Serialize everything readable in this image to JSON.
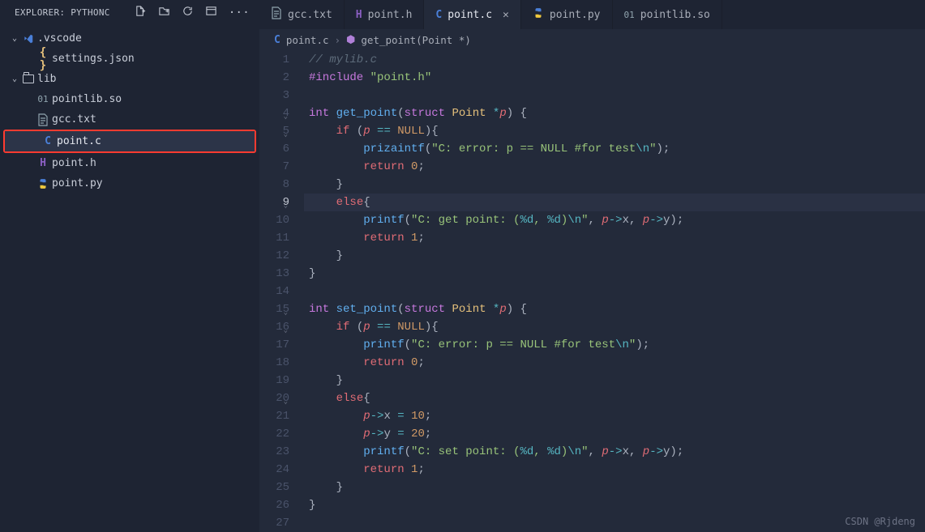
{
  "sidebar": {
    "title": "EXPLORER: PYTHONC",
    "actions": [
      "new-file",
      "new-folder",
      "refresh",
      "collapse",
      "more"
    ],
    "tree": [
      {
        "label": ".vscode",
        "icon": "vscode-folder",
        "indent": 0,
        "expanded": true
      },
      {
        "label": "settings.json",
        "icon": "json",
        "indent": 1
      },
      {
        "label": "lib",
        "icon": "folder",
        "indent": 0,
        "expanded": true
      },
      {
        "label": "pointlib.so",
        "icon": "binary",
        "indent": 1
      },
      {
        "label": "gcc.txt",
        "icon": "txt",
        "indent": 1
      },
      {
        "label": "point.c",
        "icon": "c",
        "indent": 1,
        "active": true,
        "highlighted": true
      },
      {
        "label": "point.h",
        "icon": "h",
        "indent": 1
      },
      {
        "label": "point.py",
        "icon": "py",
        "indent": 1
      }
    ]
  },
  "tabs": [
    {
      "label": "gcc.txt",
      "icon": "txt"
    },
    {
      "label": "point.h",
      "icon": "h"
    },
    {
      "label": "point.c",
      "icon": "c",
      "active": true
    },
    {
      "label": "point.py",
      "icon": "py"
    },
    {
      "label": "pointlib.so",
      "icon": "binary"
    }
  ],
  "breadcrumb": {
    "file_icon": "c",
    "file": "point.c",
    "symbol_icon": "cube",
    "symbol": "get_point(Point *)"
  },
  "editor": {
    "current_line": 9,
    "lines": [
      {
        "n": 1,
        "tokens": [
          [
            "comment",
            "// mylib.c"
          ]
        ]
      },
      {
        "n": 2,
        "tokens": [
          [
            "pre",
            "#include"
          ],
          [
            "text",
            " "
          ],
          [
            "str",
            "\"point.h\""
          ]
        ]
      },
      {
        "n": 3,
        "tokens": []
      },
      {
        "n": 4,
        "fold": true,
        "tokens": [
          [
            "type",
            "int"
          ],
          [
            "text",
            " "
          ],
          [
            "fn",
            "get_point"
          ],
          [
            "punc",
            "("
          ],
          [
            "kw",
            "struct"
          ],
          [
            "text",
            " "
          ],
          [
            "struct",
            "Point"
          ],
          [
            "text",
            " "
          ],
          [
            "op",
            "*"
          ],
          [
            "param",
            "p"
          ],
          [
            "punc",
            ")"
          ],
          [
            "text",
            " "
          ],
          [
            "punc",
            "{"
          ]
        ]
      },
      {
        "n": 5,
        "fold": true,
        "tokens": [
          [
            "text",
            "    "
          ],
          [
            "kw2",
            "if"
          ],
          [
            "text",
            " "
          ],
          [
            "punc",
            "("
          ],
          [
            "param",
            "p"
          ],
          [
            "text",
            " "
          ],
          [
            "op",
            "=="
          ],
          [
            "text",
            " "
          ],
          [
            "const",
            "NULL"
          ],
          [
            "punc",
            ")"
          ],
          [
            "punc",
            "{"
          ]
        ]
      },
      {
        "n": 6,
        "tokens": [
          [
            "text",
            "        "
          ],
          [
            "fn",
            "prizaintf"
          ],
          [
            "punc",
            "("
          ],
          [
            "str",
            "\"C: error: p == NULL #for test"
          ],
          [
            "esc",
            "\\n"
          ],
          [
            "str",
            "\""
          ],
          [
            "punc",
            ")"
          ],
          [
            "punc",
            ";"
          ]
        ]
      },
      {
        "n": 7,
        "tokens": [
          [
            "text",
            "        "
          ],
          [
            "kw2",
            "return"
          ],
          [
            "text",
            " "
          ],
          [
            "num",
            "0"
          ],
          [
            "punc",
            ";"
          ]
        ]
      },
      {
        "n": 8,
        "tokens": [
          [
            "text",
            "    "
          ],
          [
            "punc",
            "}"
          ]
        ]
      },
      {
        "n": 9,
        "fold": true,
        "tokens": [
          [
            "text",
            "    "
          ],
          [
            "kw2",
            "else"
          ],
          [
            "punc",
            "{"
          ]
        ]
      },
      {
        "n": 10,
        "tokens": [
          [
            "text",
            "        "
          ],
          [
            "fn",
            "printf"
          ],
          [
            "punc",
            "("
          ],
          [
            "str",
            "\"C: get point: ("
          ],
          [
            "esc",
            "%d"
          ],
          [
            "str",
            ", "
          ],
          [
            "esc",
            "%d"
          ],
          [
            "str",
            ")"
          ],
          [
            "esc",
            "\\n"
          ],
          [
            "str",
            "\""
          ],
          [
            "punc",
            ","
          ],
          [
            "text",
            " "
          ],
          [
            "param",
            "p"
          ],
          [
            "op",
            "->"
          ],
          [
            "text",
            "x"
          ],
          [
            "punc",
            ","
          ],
          [
            "text",
            " "
          ],
          [
            "param",
            "p"
          ],
          [
            "op",
            "->"
          ],
          [
            "text",
            "y"
          ],
          [
            "punc",
            ")"
          ],
          [
            "punc",
            ";"
          ]
        ]
      },
      {
        "n": 11,
        "tokens": [
          [
            "text",
            "        "
          ],
          [
            "kw2",
            "return"
          ],
          [
            "text",
            " "
          ],
          [
            "num",
            "1"
          ],
          [
            "punc",
            ";"
          ]
        ]
      },
      {
        "n": 12,
        "tokens": [
          [
            "text",
            "    "
          ],
          [
            "punc",
            "}"
          ]
        ]
      },
      {
        "n": 13,
        "tokens": [
          [
            "punc",
            "}"
          ]
        ]
      },
      {
        "n": 14,
        "tokens": []
      },
      {
        "n": 15,
        "fold": true,
        "tokens": [
          [
            "type",
            "int"
          ],
          [
            "text",
            " "
          ],
          [
            "fn",
            "set_point"
          ],
          [
            "punc",
            "("
          ],
          [
            "kw",
            "struct"
          ],
          [
            "text",
            " "
          ],
          [
            "struct",
            "Point"
          ],
          [
            "text",
            " "
          ],
          [
            "op",
            "*"
          ],
          [
            "param",
            "p"
          ],
          [
            "punc",
            ")"
          ],
          [
            "text",
            " "
          ],
          [
            "punc",
            "{"
          ]
        ]
      },
      {
        "n": 16,
        "fold": true,
        "tokens": [
          [
            "text",
            "    "
          ],
          [
            "kw2",
            "if"
          ],
          [
            "text",
            " "
          ],
          [
            "punc",
            "("
          ],
          [
            "param",
            "p"
          ],
          [
            "text",
            " "
          ],
          [
            "op",
            "=="
          ],
          [
            "text",
            " "
          ],
          [
            "const",
            "NULL"
          ],
          [
            "punc",
            ")"
          ],
          [
            "punc",
            "{"
          ]
        ]
      },
      {
        "n": 17,
        "tokens": [
          [
            "text",
            "        "
          ],
          [
            "fn",
            "printf"
          ],
          [
            "punc",
            "("
          ],
          [
            "str",
            "\"C: error: p == NULL #for test"
          ],
          [
            "esc",
            "\\n"
          ],
          [
            "str",
            "\""
          ],
          [
            "punc",
            ")"
          ],
          [
            "punc",
            ";"
          ]
        ]
      },
      {
        "n": 18,
        "tokens": [
          [
            "text",
            "        "
          ],
          [
            "kw2",
            "return"
          ],
          [
            "text",
            " "
          ],
          [
            "num",
            "0"
          ],
          [
            "punc",
            ";"
          ]
        ]
      },
      {
        "n": 19,
        "tokens": [
          [
            "text",
            "    "
          ],
          [
            "punc",
            "}"
          ]
        ]
      },
      {
        "n": 20,
        "fold": true,
        "tokens": [
          [
            "text",
            "    "
          ],
          [
            "kw2",
            "else"
          ],
          [
            "punc",
            "{"
          ]
        ]
      },
      {
        "n": 21,
        "tokens": [
          [
            "text",
            "        "
          ],
          [
            "param",
            "p"
          ],
          [
            "op",
            "->"
          ],
          [
            "text",
            "x "
          ],
          [
            "op",
            "="
          ],
          [
            "text",
            " "
          ],
          [
            "num",
            "10"
          ],
          [
            "punc",
            ";"
          ]
        ]
      },
      {
        "n": 22,
        "tokens": [
          [
            "text",
            "        "
          ],
          [
            "param",
            "p"
          ],
          [
            "op",
            "->"
          ],
          [
            "text",
            "y "
          ],
          [
            "op",
            "="
          ],
          [
            "text",
            " "
          ],
          [
            "num",
            "20"
          ],
          [
            "punc",
            ";"
          ]
        ]
      },
      {
        "n": 23,
        "tokens": [
          [
            "text",
            "        "
          ],
          [
            "fn",
            "printf"
          ],
          [
            "punc",
            "("
          ],
          [
            "str",
            "\"C: set point: ("
          ],
          [
            "esc",
            "%d"
          ],
          [
            "str",
            ", "
          ],
          [
            "esc",
            "%d"
          ],
          [
            "str",
            ")"
          ],
          [
            "esc",
            "\\n"
          ],
          [
            "str",
            "\""
          ],
          [
            "punc",
            ","
          ],
          [
            "text",
            " "
          ],
          [
            "param",
            "p"
          ],
          [
            "op",
            "->"
          ],
          [
            "text",
            "x"
          ],
          [
            "punc",
            ","
          ],
          [
            "text",
            " "
          ],
          [
            "param",
            "p"
          ],
          [
            "op",
            "->"
          ],
          [
            "text",
            "y"
          ],
          [
            "punc",
            ")"
          ],
          [
            "punc",
            ";"
          ]
        ]
      },
      {
        "n": 24,
        "tokens": [
          [
            "text",
            "        "
          ],
          [
            "kw2",
            "return"
          ],
          [
            "text",
            " "
          ],
          [
            "num",
            "1"
          ],
          [
            "punc",
            ";"
          ]
        ]
      },
      {
        "n": 25,
        "tokens": [
          [
            "text",
            "    "
          ],
          [
            "punc",
            "}"
          ]
        ]
      },
      {
        "n": 26,
        "tokens": [
          [
            "punc",
            "}"
          ]
        ]
      },
      {
        "n": 27,
        "tokens": []
      }
    ]
  },
  "watermark": "CSDN @Rjdeng"
}
